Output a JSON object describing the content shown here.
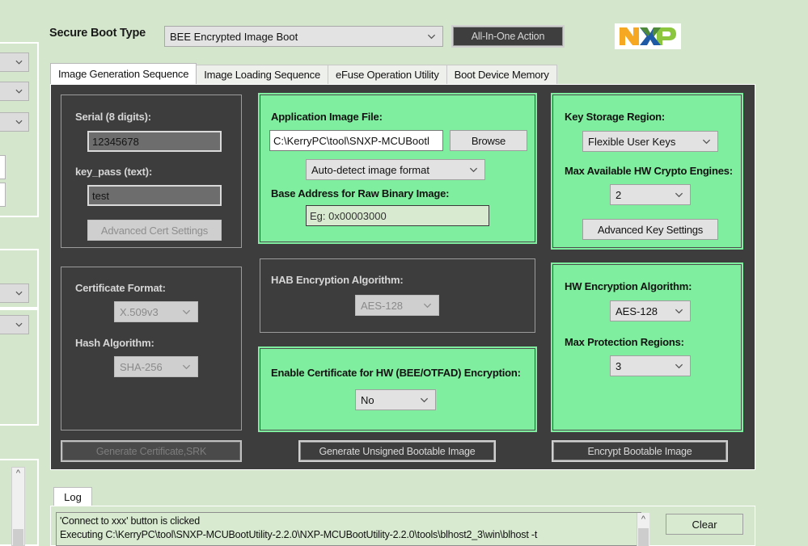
{
  "header": {
    "secure_boot_label": "Secure Boot Type",
    "secure_boot_value": "BEE Encrypted Image Boot",
    "all_in_one_label": "All-In-One Action",
    "logo": "nxp-logo"
  },
  "tabs": [
    {
      "label": "Image Generation Sequence",
      "active": true
    },
    {
      "label": "Image Loading Sequence",
      "active": false
    },
    {
      "label": "eFuse Operation Utility",
      "active": false
    },
    {
      "label": "Boot Device Memory",
      "active": false
    }
  ],
  "panels": {
    "cert_inputs": {
      "serial_label": "Serial (8 digits):",
      "serial_value": "12345678",
      "key_pass_label": "key_pass (text):",
      "key_pass_value": "test",
      "advanced_cert_button": "Advanced Cert Settings"
    },
    "app_image": {
      "file_label": "Application Image File:",
      "file_value": "C:\\KerryPC\\tool\\SNXP-MCUBootl",
      "browse_button": "Browse",
      "format_value": "Auto-detect image format",
      "base_addr_label": "Base Address for Raw Binary Image:",
      "base_addr_placeholder": "Eg: 0x00003000"
    },
    "key_storage": {
      "region_label": "Key Storage Region:",
      "region_value": "Flexible User Keys",
      "engines_label": "Max Available HW Crypto Engines:",
      "engines_value": "2",
      "advanced_key_button": "Advanced Key Settings"
    },
    "cert_format": {
      "format_label": "Certificate Format:",
      "format_value": "X.509v3",
      "hash_label": "Hash Algorithm:",
      "hash_value": "SHA-256"
    },
    "hab_enc": {
      "label": "HAB Encryption Algorithm:",
      "value": "AES-128"
    },
    "enable_cert": {
      "label": "Enable Certificate for HW (BEE/OTFAD) Encryption:",
      "value": "No"
    },
    "hw_enc": {
      "algo_label": "HW Encryption Algorithm:",
      "algo_value": "AES-128",
      "regions_label": "Max Protection Regions:",
      "regions_value": "3"
    }
  },
  "actions": {
    "generate_cert_srk": "Generate Certificate,SRK",
    "generate_unsigned": "Generate Unsigned Bootable Image",
    "encrypt_bootable": "Encrypt Bootable Image"
  },
  "log": {
    "tab_label": "Log",
    "clear_button": "Clear",
    "lines": [
      "'Connect to xxx' button is clicked",
      "Executing C:\\KerryPC\\tool\\SNXP-MCUBootUtility-2.2.0\\NXP-MCUBootUtility-2.2.0\\tools\\blhost2_3\\win\\blhost -t"
    ]
  },
  "colors": {
    "app_background": "#d4e7cd",
    "page_background": "#3d3d3d",
    "green_panel": "#7fee9e",
    "accent_dark_button": "#3e3e3e"
  }
}
